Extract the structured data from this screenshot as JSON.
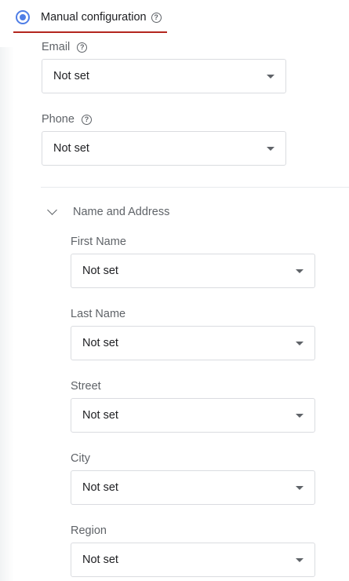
{
  "config": {
    "mode_label": "Manual configuration",
    "help_glyph": "?"
  },
  "top_fields": [
    {
      "label": "Email",
      "value": "Not set",
      "has_help": true
    },
    {
      "label": "Phone",
      "value": "Not set",
      "has_help": true
    }
  ],
  "name_address": {
    "title": "Name and Address",
    "fields": [
      {
        "label": "First Name",
        "value": "Not set"
      },
      {
        "label": "Last Name",
        "value": "Not set"
      },
      {
        "label": "Street",
        "value": "Not set"
      },
      {
        "label": "City",
        "value": "Not set"
      },
      {
        "label": "Region",
        "value": "Not set"
      }
    ]
  },
  "colors": {
    "accent": "#4f7ee6",
    "underline": "#b3261e",
    "border": "#dadce0",
    "muted_text": "#5f6368"
  }
}
